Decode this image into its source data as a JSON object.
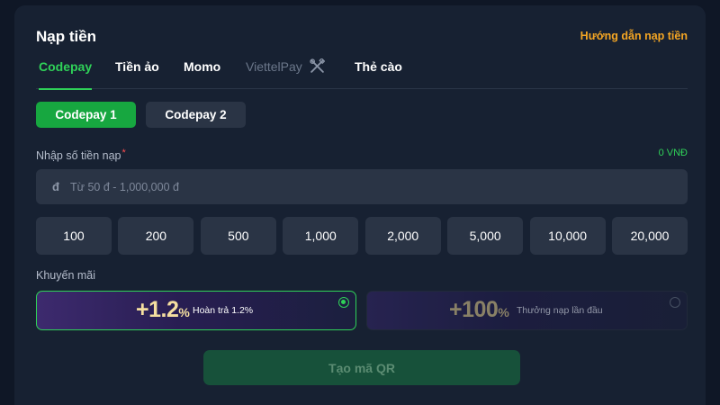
{
  "header": {
    "title": "Nạp tiền",
    "guide_link": "Hướng dẫn nạp tiền"
  },
  "tabs": [
    {
      "label": "Codepay",
      "state": "active"
    },
    {
      "label": "Tiền ảo",
      "state": "normal"
    },
    {
      "label": "Momo",
      "state": "normal"
    },
    {
      "label": "ViettelPay",
      "state": "disabled",
      "icon": "tools-icon"
    },
    {
      "label": "Thẻ cào",
      "state": "normal"
    }
  ],
  "sub_tabs": [
    {
      "label": "Codepay 1",
      "state": "active"
    },
    {
      "label": "Codepay 2",
      "state": "inactive"
    }
  ],
  "amount": {
    "label": "Nhập số tiền nạp",
    "required_mark": "*",
    "balance": "0 VNĐ",
    "currency_symbol": "đ",
    "placeholder": "Từ 50 đ - 1,000,000 đ",
    "value": ""
  },
  "presets": [
    "100",
    "200",
    "500",
    "1,000",
    "2,000",
    "5,000",
    "10,000",
    "20,000"
  ],
  "promotions": {
    "label": "Khuyến mãi",
    "items": [
      {
        "value": "+1.2",
        "unit": "%",
        "description": "Hoàn trả 1.2%",
        "selected": true
      },
      {
        "value": "+100",
        "unit": "%",
        "description": "Thưởng nạp lần đầu",
        "selected": false
      }
    ]
  },
  "submit_label": "Tạo mã QR",
  "colors": {
    "accent": "#2fd158",
    "primary_button": "#17a740",
    "link": "#f5a623",
    "panel": "#172132",
    "background": "#0f1726"
  }
}
